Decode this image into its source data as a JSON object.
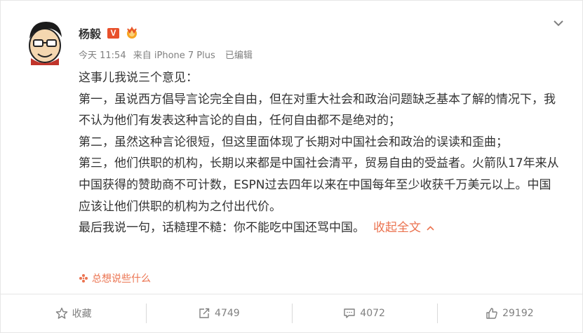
{
  "post": {
    "author": "杨毅",
    "vip_badge": "V",
    "meta": {
      "time": "今天 11:54",
      "source": "来自 iPhone 7 Plus",
      "edited": "已编辑"
    },
    "paragraphs": [
      "这事儿我说三个意见：",
      "第一，虽说西方倡导言论完全自由，但在对重大社会和政治问题缺乏基本了解的情况下，我不认为他们有发表这种言论的自由，任何自由都不是绝对的；",
      "第二，虽然这种言论很短，但这里面体现了长期对中国社会和政治的误读和歪曲；",
      "第三，他们供职的机构，长期以来都是中国社会清平，贸易自由的受益者。火箭队17年来从中国获得的赞助商不可计数，ESPN过去四年以来在中国每年至少收获千万美元以上。中国应该让他们供职的机构为之付出代价。",
      "最后我说一句，话糙理不糙：你不能吃中国还骂中国。"
    ],
    "collapse_label": "收起全文",
    "comment_hint": "总想说些什么"
  },
  "actions": {
    "favorite": "收藏",
    "repost": "4749",
    "comment": "4072",
    "like": "29192"
  },
  "colors": {
    "accent": "#eb7350",
    "text": "#333333",
    "muted": "#808080",
    "vip": "#e8502b"
  }
}
